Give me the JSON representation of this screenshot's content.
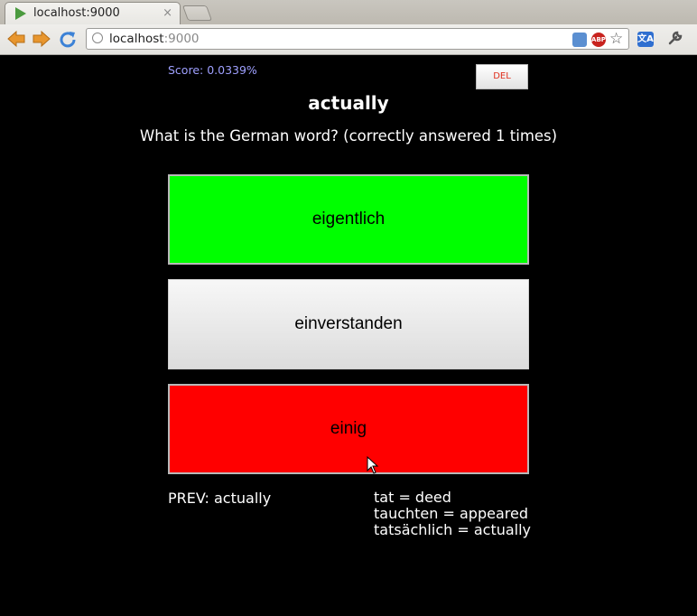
{
  "browser": {
    "tab_title": "localhost:9000",
    "tab_close": "×",
    "url_host": "localhost",
    "url_port": ":9000",
    "abp_label": "ABP",
    "translate_label": "文A"
  },
  "page": {
    "score_text": "Score: 0.0339%",
    "del_label": "DEL",
    "word": "actually",
    "question": "What is the German word? (correctly answered 1 times)",
    "answers": [
      {
        "label": "eigentlich",
        "state": "correct",
        "color": "#00ff00"
      },
      {
        "label": "einverstanden",
        "state": "neutral",
        "color": "#e8e8e8"
      },
      {
        "label": "einig",
        "state": "wrong",
        "color": "#ff0000"
      }
    ],
    "prev": "PREV: actually",
    "recent": [
      "tat = deed",
      "tauchten = appeared",
      "tatsächlich = actually"
    ]
  },
  "colors": {
    "score": "#9fa0ff",
    "del_text": "#e0301e",
    "background": "#000000"
  }
}
